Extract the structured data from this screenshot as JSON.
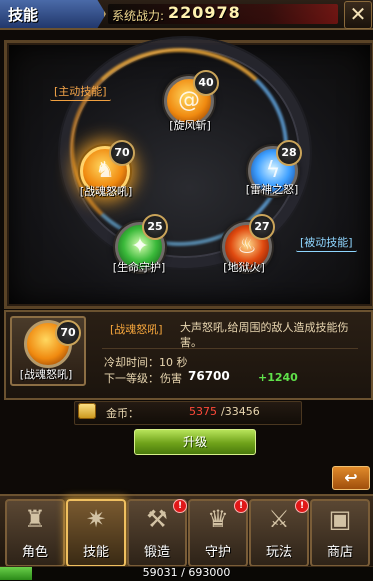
{
  "header": {
    "title": "技能",
    "power_label": "系统战力:",
    "power_value": "220978",
    "close_label": "✕"
  },
  "skill_board": {
    "active_tag": "[主动技能]",
    "passive_tag": "[被动技能]",
    "skills": [
      {
        "name": "[旋风斩]",
        "level": "40",
        "icon": "whirlwind-icon"
      },
      {
        "name": "[战魂怒吼]",
        "level": "70",
        "icon": "war-cry-icon",
        "selected": true
      },
      {
        "name": "[雷神之怒]",
        "level": "28",
        "icon": "thunder-icon"
      },
      {
        "name": "[生命守护]",
        "level": "25",
        "icon": "life-guard-icon"
      },
      {
        "name": "[地狱火]",
        "level": "27",
        "icon": "hellfire-icon"
      }
    ]
  },
  "detail": {
    "icon_level": "70",
    "icon_name": "[战魂怒吼]",
    "skill_name": "[战魂怒吼]",
    "description": "大声怒吼,给周围的敌人造成技能伤害。",
    "cooldown": "冷却时间：10 秒",
    "next_level_label": "下一等级：",
    "damage_label": "伤害",
    "damage_value": "76700",
    "damage_bonus": "+1240"
  },
  "gold": {
    "label": "金币：",
    "current": "5375",
    "required": "/33456"
  },
  "upgrade_label": "升级",
  "back_label": "↩",
  "nav": [
    {
      "label": "角色",
      "icon": "helmet-icon"
    },
    {
      "label": "技能",
      "icon": "skill-book-icon",
      "active": true
    },
    {
      "label": "锻造",
      "icon": "anvil-icon",
      "alert": "!"
    },
    {
      "label": "守护",
      "icon": "guardian-icon",
      "alert": "!"
    },
    {
      "label": "玩法",
      "icon": "crossed-swords-icon",
      "alert": "!"
    },
    {
      "label": "商店",
      "icon": "treasure-chest-icon"
    }
  ],
  "exp": {
    "text": "59031 / 693000",
    "current": 59031,
    "max": 693000
  },
  "colors": {
    "accent_gold": "#f0c060",
    "cost_insufficient": "#ff4a3a",
    "bonus_green": "#5fe04a",
    "active_skill_tag": "#f5a64a",
    "passive_skill_tag": "#8fd6ff"
  }
}
